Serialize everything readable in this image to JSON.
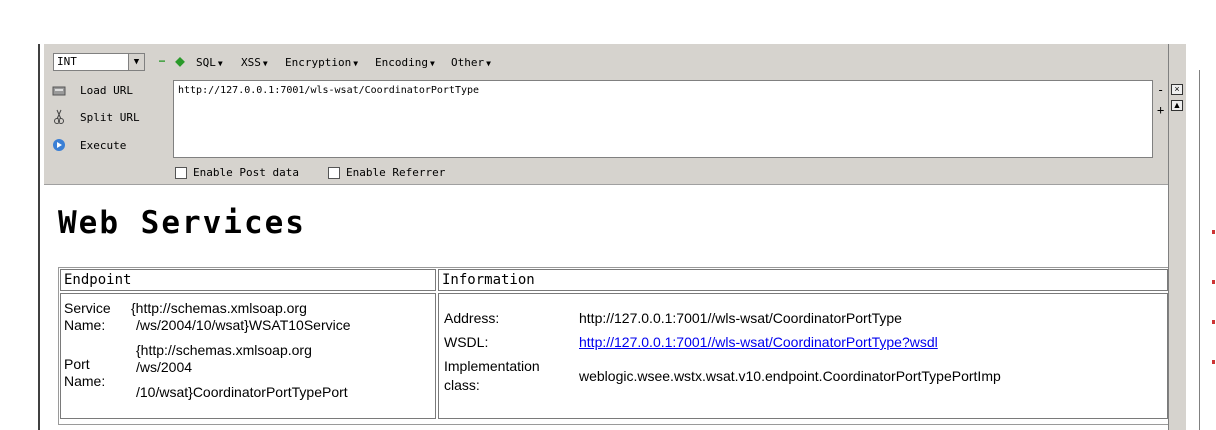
{
  "toolbar": {
    "select_value": "INT",
    "minus_symbol": "−",
    "plus_symbol": "+",
    "menus": [
      "SQL",
      "XSS",
      "Encryption",
      "Encoding",
      "Other"
    ],
    "load_url_label": "Load URL",
    "split_url_label": "Split URL",
    "execute_label": "Execute",
    "url_value": "http://127.0.0.1:7001/wls-wsat/CoordinatorPortType",
    "side_minus": "-",
    "side_plus": "+",
    "enable_post_label": "Enable Post data",
    "enable_referrer_label": "Enable Referrer"
  },
  "page": {
    "heading": "Web Services",
    "table": {
      "col_endpoint": "Endpoint",
      "col_information": "Information",
      "service_name_label_1": "Service",
      "service_name_label_2": "Name:",
      "service_name_value_1": "{http://schemas.xmlsoap.org",
      "service_name_value_2": "/ws/2004/10/wsat}WSAT10Service",
      "port_name_label_1": "Port",
      "port_name_label_2": "Name:",
      "port_name_value_1": "{http://schemas.xmlsoap.org",
      "port_name_value_2": "/ws/2004",
      "port_name_value_3": "/10/wsat}CoordinatorPortTypePort",
      "address_label": "Address:",
      "address_value": "http://127.0.0.1:7001//wls-wsat/CoordinatorPortType",
      "wsdl_label": "WSDL:",
      "wsdl_value": "http://127.0.0.1:7001//wls-wsat/CoordinatorPortType?wsdl",
      "impl_label_1": "Implementation",
      "impl_label_2": "class:",
      "impl_value": "weblogic.wsee.wstx.wsat.v10.endpoint.CoordinatorPortTypePortImp"
    }
  },
  "colors": {
    "toolbar_bg": "#d6d3ce",
    "link": "#0000ee",
    "minus": "#22aa22",
    "plus": "#22aa22"
  },
  "icons": {
    "load": "load-url-icon",
    "split": "scissors-icon",
    "execute": "play-icon"
  }
}
